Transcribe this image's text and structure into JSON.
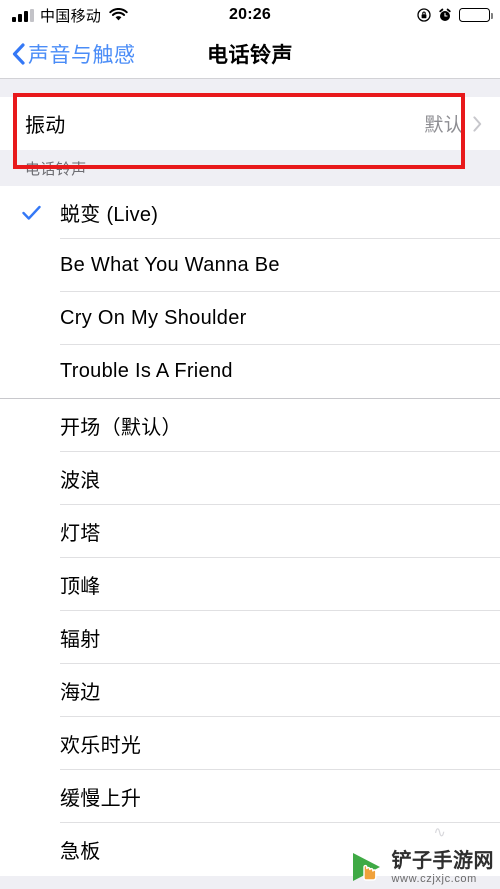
{
  "status_bar": {
    "carrier": "中国移动",
    "time": "20:26",
    "signal_icon": "cellular-signal-icon",
    "wifi_icon": "wifi-icon",
    "rotation_lock_icon": "rotation-lock-icon",
    "alarm_icon": "alarm-clock-icon",
    "battery_icon": "battery-icon"
  },
  "nav": {
    "back_label": "声音与触感",
    "back_icon": "chevron-left-icon",
    "title": "电话铃声"
  },
  "vibration_row": {
    "label": "振动",
    "value": "默认",
    "disclosure_icon": "chevron-right-icon"
  },
  "section": {
    "header": "电话铃声"
  },
  "ringtones_custom": [
    {
      "name": "蜕变 (Live)",
      "selected": true
    },
    {
      "name": "Be What You Wanna Be",
      "selected": false
    },
    {
      "name": "Cry On My Shoulder",
      "selected": false
    },
    {
      "name": "Trouble Is A Friend",
      "selected": false
    }
  ],
  "ringtones_system": [
    {
      "name": "开场（默认）",
      "selected": false
    },
    {
      "name": "波浪",
      "selected": false
    },
    {
      "name": "灯塔",
      "selected": false
    },
    {
      "name": "顶峰",
      "selected": false
    },
    {
      "name": "辐射",
      "selected": false
    },
    {
      "name": "海边",
      "selected": false
    },
    {
      "name": "欢乐时光",
      "selected": false
    },
    {
      "name": "缓慢上升",
      "selected": false
    },
    {
      "name": "急板",
      "selected": false
    }
  ],
  "highlight": {
    "color": "#e8191b"
  },
  "watermark": {
    "name": "铲子手游网",
    "url": "www.czjxjc.com",
    "logo_icon": "cursor-arrow-logo-icon"
  },
  "colors": {
    "accent": "#3478f6",
    "background": "#efeff4",
    "row": "#ffffff",
    "secondary_text": "#8e8e93"
  }
}
